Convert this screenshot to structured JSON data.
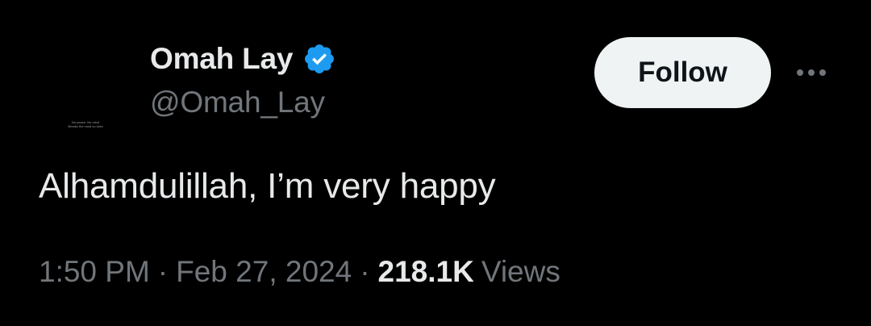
{
  "tweet": {
    "author": {
      "display_name": "Omah Lay",
      "handle": "@Omah_Lay",
      "verified": true,
      "verified_color": "#1d9bf0",
      "avatar_text_line1": "No peace. No mind",
      "avatar_text_line2": "Breaks the mind so wise"
    },
    "follow_label": "Follow",
    "more_icon": "ellipsis-icon",
    "text": "Alhamdulillah, I’m very happy",
    "meta": {
      "time": "1:50 PM",
      "separator": "·",
      "date": "Feb 27, 2024",
      "views_count": "218.1K",
      "views_label": "Views"
    }
  },
  "colors": {
    "background": "#000000",
    "primary_text": "#e7e9ea",
    "secondary_text": "#71767b",
    "follow_bg": "#eff3f4",
    "follow_text": "#0f1419"
  }
}
